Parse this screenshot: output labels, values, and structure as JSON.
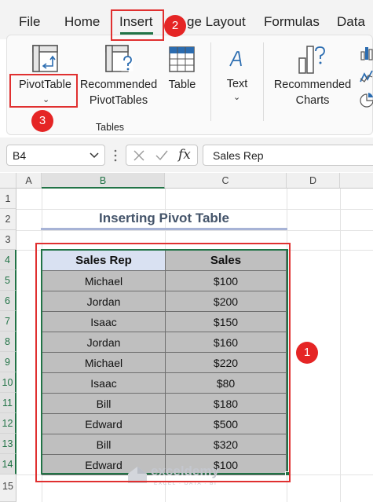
{
  "menu": {
    "tabs": [
      "File",
      "Home",
      "Insert",
      "ge Layout",
      "Formulas",
      "Data"
    ]
  },
  "ribbon": {
    "pivot_label": "PivotTable",
    "recommended_pivot_line1": "Recommended",
    "recommended_pivot_line2": "PivotTables",
    "table_label": "Table",
    "text_label": "Text",
    "rec_charts_line1": "Recommended",
    "rec_charts_line2": "Charts",
    "group_tables": "Tables"
  },
  "formula_bar": {
    "name_box": "B4",
    "formula_value": "Sales Rep",
    "fx": "fx"
  },
  "columns": [
    "A",
    "B",
    "C",
    "D"
  ],
  "rows": [
    "1",
    "2",
    "3",
    "4",
    "5",
    "6",
    "7",
    "8",
    "9",
    "10",
    "11",
    "12",
    "13",
    "14",
    "15"
  ],
  "sheet": {
    "title": "Inserting Pivot Table",
    "headers": [
      "Sales Rep",
      "Sales"
    ],
    "rows": [
      [
        "Michael",
        "$100"
      ],
      [
        "Jordan",
        "$200"
      ],
      [
        "Isaac",
        "$150"
      ],
      [
        "Jordan",
        "$160"
      ],
      [
        "Michael",
        "$220"
      ],
      [
        "Isaac",
        "$80"
      ],
      [
        "Bill",
        "$180"
      ],
      [
        "Edward",
        "$500"
      ],
      [
        "Bill",
        "$320"
      ],
      [
        "Edward",
        "$100"
      ]
    ]
  },
  "annotations": {
    "badge1": "1",
    "badge2": "2",
    "badge3": "3"
  },
  "watermark": {
    "name": "exceldemy",
    "tagline": "EXCEL · DATA · BI"
  },
  "colors": {
    "accent_green": "#217346",
    "annotation_red": "#e03030",
    "header_blue": "#d9e1f2",
    "cell_gray": "#bfbfbf"
  }
}
